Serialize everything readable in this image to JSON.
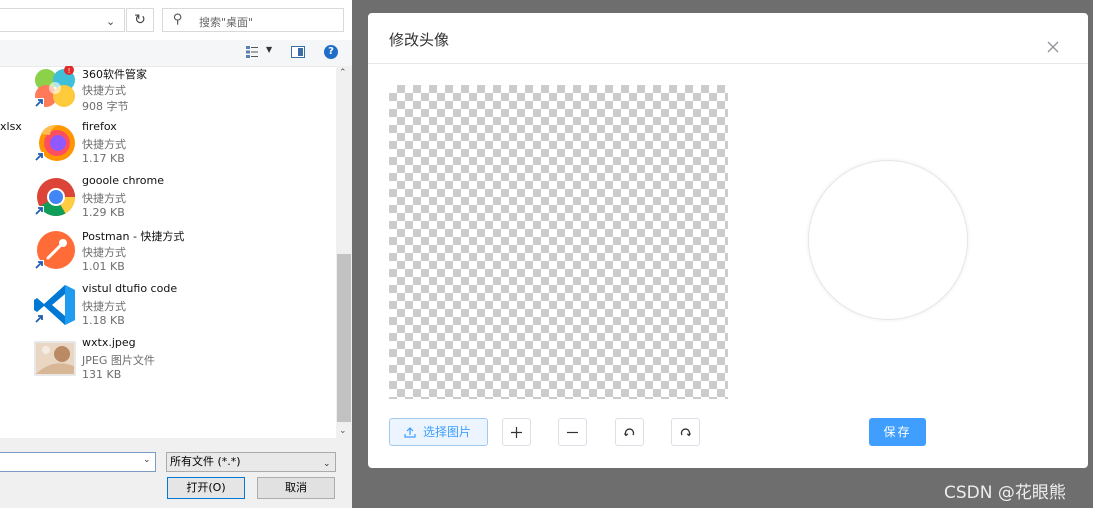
{
  "file_dialog": {
    "search_placeholder": "搜索\"桌面\"",
    "partial_filename": "xlsx",
    "files": [
      {
        "name": "360软件管家",
        "type": "快捷方式",
        "size": "908 字节",
        "icon": "360-software-manager-icon"
      },
      {
        "name": "firefox",
        "type": "快捷方式",
        "size": "1.17 KB",
        "icon": "firefox-icon"
      },
      {
        "name": "gooole chrome",
        "type": "快捷方式",
        "size": "1.29 KB",
        "icon": "chrome-icon"
      },
      {
        "name": "Postman - 快捷方式",
        "type": "快捷方式",
        "size": "1.01 KB",
        "icon": "postman-icon"
      },
      {
        "name": "vistul dtufio  code",
        "type": "快捷方式",
        "size": "1.18 KB",
        "icon": "vscode-icon"
      },
      {
        "name": "wxtx.jpeg",
        "type": "JPEG 图片文件",
        "size": "131 KB",
        "icon": "image-thumbnail"
      }
    ],
    "filename_value": "",
    "filetype_value": "所有文件 (*.*)",
    "open_label": "打开(O)",
    "cancel_label": "取消"
  },
  "modal": {
    "title": "修改头像",
    "select_image_label": "选择图片",
    "save_label": "保存"
  },
  "watermark": "CSDN @花眼熊",
  "colors": {
    "primary": "#409eff",
    "dialog_overlay": "#6e6e6e"
  }
}
